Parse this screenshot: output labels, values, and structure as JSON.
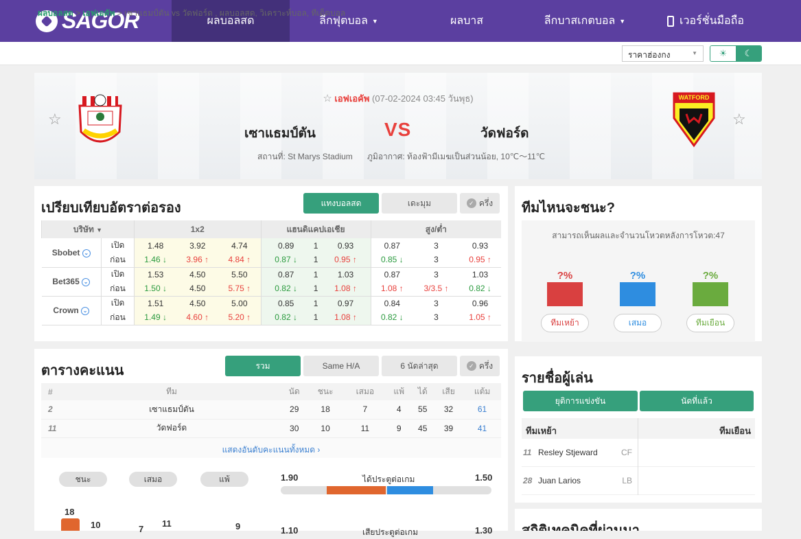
{
  "nav": {
    "logo": "SAGOR",
    "items": [
      "ผลบอลสด",
      "ลีกฟุตบอล",
      "ผลบาส",
      "ลีกบาสเกตบอล",
      "เวอร์ชั่นมือถือ"
    ]
  },
  "breadcrumb": {
    "home": "ผลบอลสด",
    "sep": ">",
    "league": "เอฟเอคัพ",
    "rest": "เซาแธมป์ตัน vs วัดฟอร์ด , ผลบอลสด, วิเคราะห์บอล, ทีเด็ดบอล"
  },
  "odds_select": "ราคาฮ่องกง",
  "match": {
    "league": "เอฟเอคัพ",
    "datetime": "(07-02-2024 03:45 วันพุธ)",
    "home": "เซาแธมป์ตัน",
    "away": "วัดฟอร์ด",
    "vs": "VS",
    "venue": "สถานที่: St Marys Stadium",
    "weather": "ภูมิอากาศ: ท้องฟ้ามีเมฆเป็นส่วนน้อย, 10℃～11℃",
    "away_badge_text": "WATFORD",
    "home_badge_text": "SOUTHAMPTON FC"
  },
  "odds": {
    "title": "เปรียบเทียบอัตราต่อรอง",
    "tabs": [
      "แทงบอลสด",
      "เดะมุม",
      "ครึ่ง"
    ],
    "headers": [
      "บริษัท",
      "1x2",
      "แฮนดิแคปเอเชีย",
      "สูง/ต่ำ"
    ],
    "open_label": "เปิด",
    "before_label": "ก่อน",
    "rows": [
      {
        "book": "Sbobet",
        "open": [
          "1.48",
          "3.92",
          "4.74",
          "0.89",
          "1",
          "0.93",
          "0.87",
          "3",
          "0.93"
        ],
        "before": [
          "1.46",
          "3.96",
          "4.84",
          "0.87",
          "1",
          "0.95",
          "0.85",
          "3",
          "0.95"
        ],
        "dir": [
          "dn",
          "up",
          "up",
          "dn",
          "",
          "up",
          "dn",
          "",
          "up"
        ]
      },
      {
        "book": "Bet365",
        "open": [
          "1.53",
          "4.50",
          "5.50",
          "0.87",
          "1",
          "1.03",
          "0.87",
          "3",
          "1.03"
        ],
        "before": [
          "1.50",
          "4.50",
          "5.75",
          "0.82",
          "1",
          "1.08",
          "1.08",
          "3/3.5",
          "0.82"
        ],
        "dir": [
          "dn",
          "",
          "up",
          "dn",
          "",
          "up",
          "up",
          "up",
          "dn"
        ]
      },
      {
        "book": "Crown",
        "open": [
          "1.51",
          "4.50",
          "5.00",
          "0.85",
          "1",
          "0.97",
          "0.84",
          "3",
          "0.96"
        ],
        "before": [
          "1.49",
          "4.60",
          "5.20",
          "0.82",
          "1",
          "1.08",
          "0.82",
          "3",
          "1.05"
        ],
        "dir": [
          "dn",
          "up",
          "up",
          "dn",
          "",
          "up",
          "dn",
          "",
          "up"
        ]
      }
    ]
  },
  "vote": {
    "title": "ทีมไหนจะชนะ?",
    "note": "สามารถเห็นผลและจำนวนโหวตหลังการโหวต:47",
    "items": [
      {
        "pct": "?%",
        "label": "ทีมเหย้า",
        "color": "#d94040"
      },
      {
        "pct": "?%",
        "label": "เสมอ",
        "color": "#2e8de0"
      },
      {
        "pct": "?%",
        "label": "ทีมเยือน",
        "color": "#6aab3e"
      }
    ]
  },
  "standings": {
    "title": "ตารางคะแนน",
    "tabs": [
      "รวม",
      "Same H/A",
      "6 นัดล่าสุด",
      "ครึ่ง"
    ],
    "headers": [
      "#",
      "ทีม",
      "นัด",
      "ชนะ",
      "เสมอ",
      "แพ้",
      "ได้",
      "เสีย",
      "แต้ม"
    ],
    "rows": [
      [
        "2",
        "เซาแธมป์ตัน",
        "29",
        "18",
        "7",
        "4",
        "55",
        "32",
        "61"
      ],
      [
        "11",
        "วัดฟอร์ด",
        "30",
        "10",
        "11",
        "9",
        "45",
        "39",
        "41"
      ]
    ],
    "more": "แสดงอันดับคะแนนทั้งหมด"
  },
  "summary": {
    "pills": [
      "ชนะ",
      "เสมอ",
      "แพ้"
    ],
    "goals_label": "ได้ประตูต่อเกม",
    "home_goals": "1.90",
    "away_goals": "1.50",
    "bars": [
      "18",
      "10",
      "7",
      "11",
      "9"
    ],
    "conceded_label": "เสียประตูต่อเกม",
    "home_conceded": "1.10",
    "away_conceded": "1.30",
    "home_share": 0.56
  },
  "players": {
    "title": "รายชื่อผู้เล่น",
    "tabs": [
      "ยุติการแข่งขัน",
      "นัดที่แล้ว"
    ],
    "home_label": "ทีมเหย้า",
    "away_label": "ทีมเยือน",
    "list": [
      {
        "num": "11",
        "name": "Resley Stjeward",
        "pos": "CF"
      },
      {
        "num": "28",
        "name": "Juan Larios",
        "pos": "LB"
      }
    ]
  },
  "stats_title": "สถิติเทคนิคที่ผ่านมา"
}
